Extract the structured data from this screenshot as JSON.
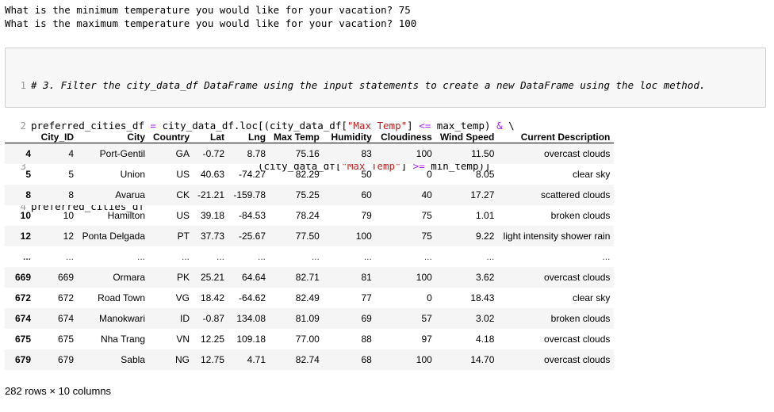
{
  "stdout": {
    "line1": "What is the minimum temperature you would like for your vacation? 75",
    "line2": "What is the maximum temperature you would like for your vacation? 100"
  },
  "code": {
    "ln1": "1",
    "ln2": "2",
    "ln3": "3",
    "ln4": "4",
    "comment": "# 3. Filter the city_data_df DataFrame using the input statements to create a new DataFrame using the loc method.",
    "l2_a": "preferred_cities_df ",
    "l2_eq": "=",
    "l2_b": " city_data_df.loc[(city_data_df[",
    "l2_str": "\"Max Temp\"",
    "l2_c": "] ",
    "l2_op": "<=",
    "l2_d": " max_temp) ",
    "l2_amp": "&",
    "l2_e": " \\",
    "l3_a": "                                      (city_data_df[",
    "l3_str": "\"Max Temp\"",
    "l3_b": "] ",
    "l3_op": ">=",
    "l3_c": " min_temp)]",
    "l4": "preferred_cities_df"
  },
  "table": {
    "columns": [
      "",
      "City_ID",
      "City",
      "Country",
      "Lat",
      "Lng",
      "Max Temp",
      "Humidity",
      "Cloudiness",
      "Wind Speed",
      "Current Description"
    ],
    "rows": [
      [
        "4",
        "4",
        "Port-Gentil",
        "GA",
        "-0.72",
        "8.78",
        "75.16",
        "83",
        "100",
        "11.50",
        "overcast clouds"
      ],
      [
        "5",
        "5",
        "Union",
        "US",
        "40.63",
        "-74.27",
        "82.29",
        "50",
        "0",
        "8.05",
        "clear sky"
      ],
      [
        "8",
        "8",
        "Avarua",
        "CK",
        "-21.21",
        "-159.78",
        "75.25",
        "60",
        "40",
        "17.27",
        "scattered clouds"
      ],
      [
        "10",
        "10",
        "Hamilton",
        "US",
        "39.18",
        "-84.53",
        "78.24",
        "79",
        "75",
        "1.01",
        "broken clouds"
      ],
      [
        "12",
        "12",
        "Ponta Delgada",
        "PT",
        "37.73",
        "-25.67",
        "77.50",
        "100",
        "75",
        "9.22",
        "light intensity shower rain"
      ],
      [
        "...",
        "...",
        "...",
        "...",
        "...",
        "...",
        "...",
        "...",
        "...",
        "...",
        "..."
      ],
      [
        "669",
        "669",
        "Ormara",
        "PK",
        "25.21",
        "64.64",
        "82.71",
        "81",
        "100",
        "3.62",
        "overcast clouds"
      ],
      [
        "672",
        "672",
        "Road Town",
        "VG",
        "18.42",
        "-64.62",
        "82.49",
        "77",
        "0",
        "18.43",
        "clear sky"
      ],
      [
        "674",
        "674",
        "Manokwari",
        "ID",
        "-0.87",
        "134.08",
        "81.09",
        "69",
        "57",
        "3.02",
        "broken clouds"
      ],
      [
        "675",
        "675",
        "Nha Trang",
        "VN",
        "12.25",
        "109.18",
        "77.00",
        "88",
        "97",
        "4.18",
        "overcast clouds"
      ],
      [
        "679",
        "679",
        "Sabla",
        "NG",
        "12.75",
        "4.71",
        "82.74",
        "68",
        "100",
        "14.70",
        "overcast clouds"
      ]
    ]
  },
  "footer": "282 rows × 10 columns"
}
